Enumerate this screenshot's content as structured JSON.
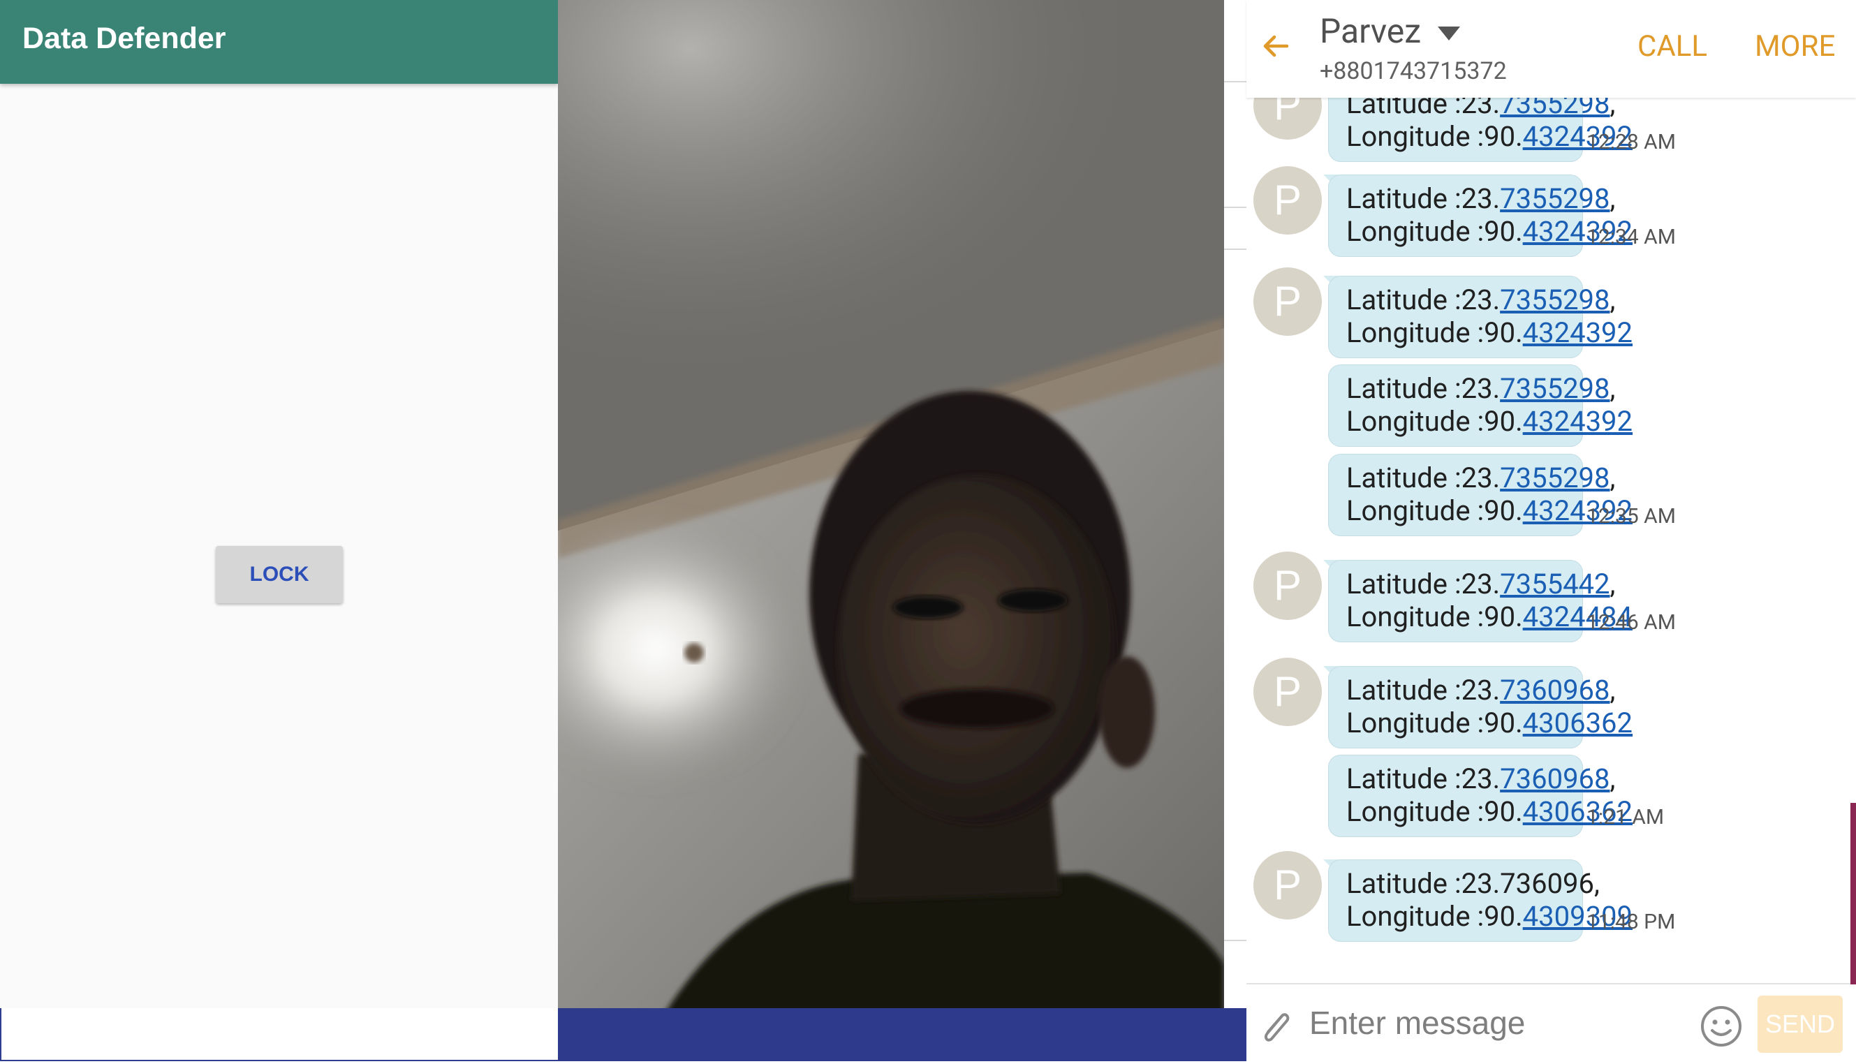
{
  "left_app": {
    "title": "Data Defender",
    "lock_label": "LOCK",
    "appbar_color": "#3a8476"
  },
  "photo": {
    "description_icon": "captured-face-photo"
  },
  "messages_app": {
    "contact_name": "Parvez",
    "contact_number": "+8801743715372",
    "call_label": "CALL",
    "more_label": "MORE",
    "accent_color": "#e09a2a",
    "avatar_letter": "P",
    "messages": [
      {
        "lat_prefix": "Latitude :23.",
        "lat_link": "7355298",
        "lat_suffix": ",",
        "lon_prefix": "Longitude :90.",
        "lon_link": "4324392",
        "time": "12:28 AM",
        "avatar": true
      },
      {
        "lat_prefix": "Latitude :23.",
        "lat_link": "7355298",
        "lat_suffix": ",",
        "lon_prefix": "Longitude :90.",
        "lon_link": "4324392",
        "time": "12:34 AM",
        "avatar": true
      },
      {
        "lat_prefix": "Latitude :23.",
        "lat_link": "7355298",
        "lat_suffix": ",",
        "lon_prefix": "Longitude :90.",
        "lon_link": "4324392",
        "time": "",
        "avatar": true
      },
      {
        "lat_prefix": "Latitude :23.",
        "lat_link": "7355298",
        "lat_suffix": ",",
        "lon_prefix": "Longitude :90.",
        "lon_link": "4324392",
        "time": "",
        "avatar": false
      },
      {
        "lat_prefix": "Latitude :23.",
        "lat_link": "7355298",
        "lat_suffix": ",",
        "lon_prefix": "Longitude :90.",
        "lon_link": "4324392",
        "time": "12:35 AM",
        "avatar": false
      },
      {
        "lat_prefix": "Latitude :23.",
        "lat_link": "7355442",
        "lat_suffix": ",",
        "lon_prefix": "Longitude :90.",
        "lon_link": "4324484",
        "time": "12:46 AM",
        "avatar": true
      },
      {
        "lat_prefix": "Latitude :23.",
        "lat_link": "7360968",
        "lat_suffix": ",",
        "lon_prefix": "Longitude :90.",
        "lon_link": "4306362",
        "time": "",
        "avatar": true
      },
      {
        "lat_prefix": "Latitude :23.",
        "lat_link": "7360968",
        "lat_suffix": ",",
        "lon_prefix": "Longitude :90.",
        "lon_link": "4306362",
        "time": "1:21 AM",
        "avatar": false
      },
      {
        "lat_prefix": "Latitude :23.736096,",
        "lat_link": "",
        "lat_suffix": "",
        "lon_prefix": "Longitude :90.",
        "lon_link": "4309309",
        "time": "11:48 PM",
        "avatar": true
      }
    ],
    "composer": {
      "placeholder": "Enter message",
      "send_label": "SEND"
    }
  }
}
